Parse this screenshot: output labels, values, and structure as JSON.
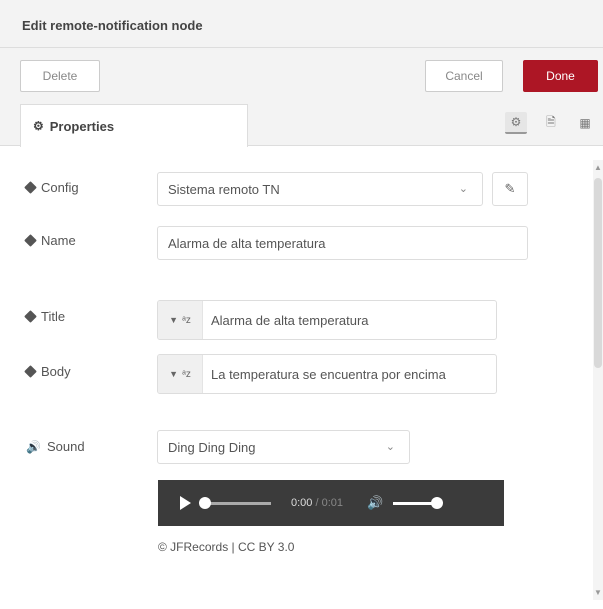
{
  "dialog": {
    "title": "Edit remote-notification node",
    "delete_label": "Delete",
    "cancel_label": "Cancel",
    "done_label": "Done"
  },
  "tabs": {
    "properties_label": "Properties",
    "icons": [
      "gear-icon",
      "description-icon",
      "appearance-icon"
    ]
  },
  "form": {
    "config": {
      "label": "Config",
      "value": "Sistema remoto TN"
    },
    "name": {
      "label": "Name",
      "value": "Alarma de alta temperatura"
    },
    "title": {
      "label": "Title",
      "type": "string",
      "value": "Alarma de alta temperatura"
    },
    "body": {
      "label": "Body",
      "type": "string",
      "value": "La temperatura se encuentra por encima"
    },
    "sound": {
      "label": "Sound",
      "value": "Ding Ding Ding"
    }
  },
  "audio": {
    "current_time": "0:00",
    "duration": "0:01",
    "progress": 0,
    "volume": 1
  },
  "credit": "© JFRecords | CC BY 3.0",
  "colors": {
    "done": "#ad1625",
    "header_bg": "#f3f3f3",
    "audio_bg": "#3b3b3b"
  }
}
